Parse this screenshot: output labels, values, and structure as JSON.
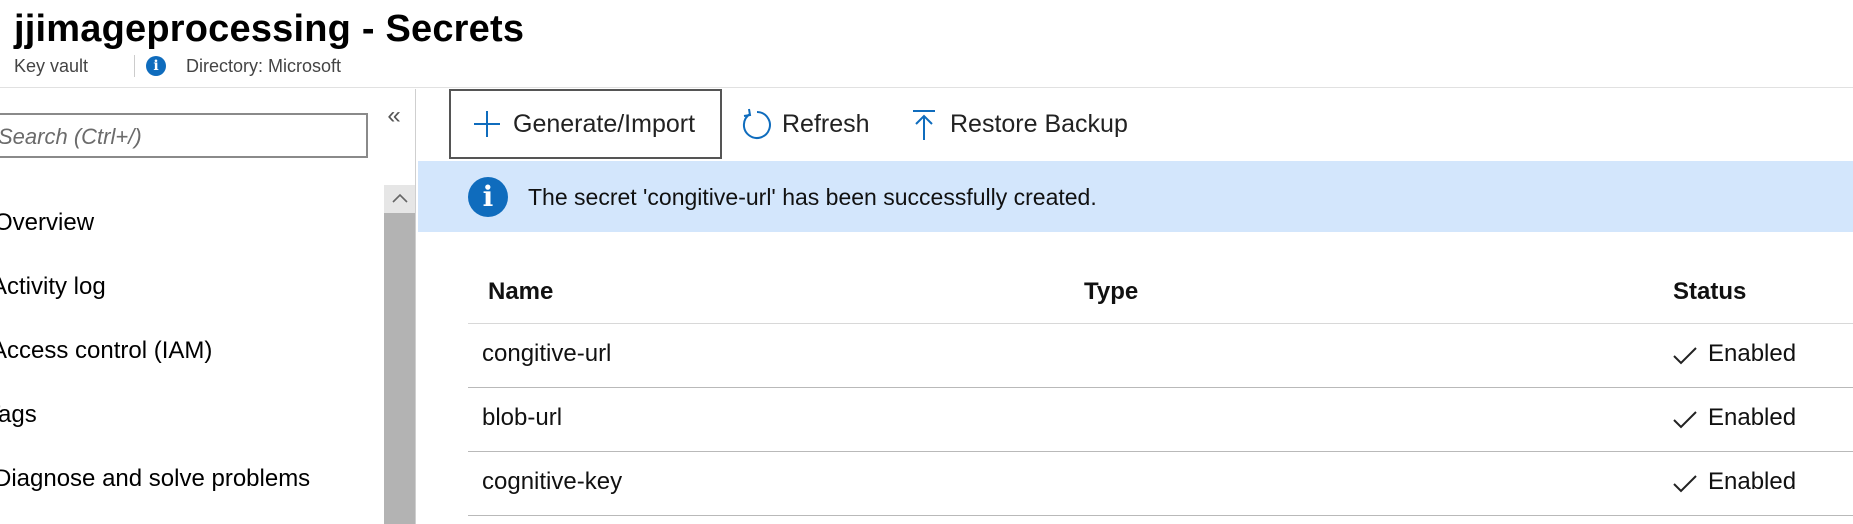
{
  "header": {
    "title": "jjimageprocessing - Secrets",
    "resource_type": "Key vault",
    "directory": "Directory: Microsoft"
  },
  "sidebar": {
    "search_placeholder": "Search (Ctrl+/)",
    "collapse_glyph": "«",
    "items": [
      {
        "label": "Overview"
      },
      {
        "label": "Activity log"
      },
      {
        "label": "Access control (IAM)"
      },
      {
        "label": "Tags"
      },
      {
        "label": "Diagnose and solve problems"
      }
    ]
  },
  "toolbar": {
    "generate_label": "Generate/Import",
    "refresh_label": "Refresh",
    "restore_label": "Restore Backup"
  },
  "notification": {
    "message": "The secret 'congitive-url' has been successfully created."
  },
  "table": {
    "columns": [
      "Name",
      "Type",
      "Status"
    ],
    "rows": [
      {
        "name": "congitive-url",
        "type": "",
        "status": "Enabled"
      },
      {
        "name": "blob-url",
        "type": "",
        "status": "Enabled"
      },
      {
        "name": "cognitive-key",
        "type": "",
        "status": "Enabled"
      }
    ]
  },
  "colors": {
    "accent": "#0f6cbd",
    "notification_bg": "#d3e6fc"
  }
}
